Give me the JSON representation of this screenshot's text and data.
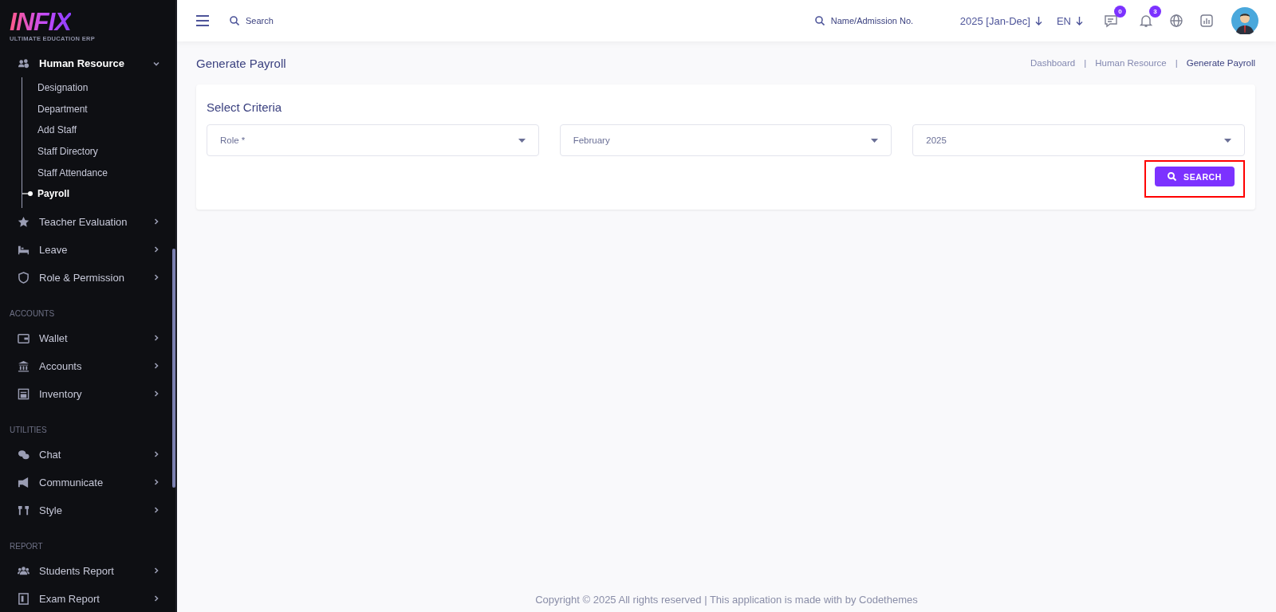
{
  "sidebar": {
    "logo": {
      "text": "INFIX",
      "tagline": "ULTIMATE EDUCATION ERP"
    },
    "sections": [
      {
        "items": [
          {
            "label": "Human Resource",
            "expanded": true,
            "children": [
              {
                "label": "Designation",
                "selected": false
              },
              {
                "label": "Department",
                "selected": false
              },
              {
                "label": "Add Staff",
                "selected": false
              },
              {
                "label": "Staff Directory",
                "selected": false
              },
              {
                "label": "Staff Attendance",
                "selected": false
              },
              {
                "label": "Payroll",
                "selected": true
              }
            ]
          },
          {
            "label": "Teacher Evaluation",
            "expanded": false
          },
          {
            "label": "Leave",
            "expanded": false
          },
          {
            "label": "Role & Permission",
            "expanded": false
          }
        ]
      },
      {
        "heading": "ACCOUNTS",
        "items": [
          {
            "label": "Wallet",
            "expanded": false
          },
          {
            "label": "Accounts",
            "expanded": false
          },
          {
            "label": "Inventory",
            "expanded": false
          }
        ]
      },
      {
        "heading": "UTILITIES",
        "items": [
          {
            "label": "Chat",
            "expanded": false
          },
          {
            "label": "Communicate",
            "expanded": false
          },
          {
            "label": "Style",
            "expanded": false
          }
        ]
      },
      {
        "heading": "REPORT",
        "items": [
          {
            "label": "Students Report",
            "expanded": false
          },
          {
            "label": "Exam Report",
            "expanded": false
          }
        ]
      }
    ]
  },
  "header": {
    "search": {
      "placeholder": "Search"
    },
    "student_search": {
      "placeholder": "Name/Admission No."
    },
    "session": "2025 [Jan-Dec]",
    "language": "EN",
    "message_count": "0",
    "notification_count": "3"
  },
  "page": {
    "title": "Generate Payroll",
    "breadcrumb_separators": [
      "|",
      "|"
    ],
    "breadcrumbs": [
      {
        "label": "Dashboard",
        "selected": false
      },
      {
        "label": "Human Resource",
        "selected": false
      },
      {
        "label": "Generate Payroll",
        "selected": true
      }
    ]
  },
  "criteria": {
    "title": "Select Criteria",
    "selects": [
      {
        "placeholder": "Role *"
      },
      {
        "value": "February"
      },
      {
        "value": "2025"
      }
    ],
    "button": {
      "label": "SEARCH",
      "highlighted": true
    }
  },
  "footer": "Copyright © 2025 All rights reserved | This application is made with by Codethemes"
}
